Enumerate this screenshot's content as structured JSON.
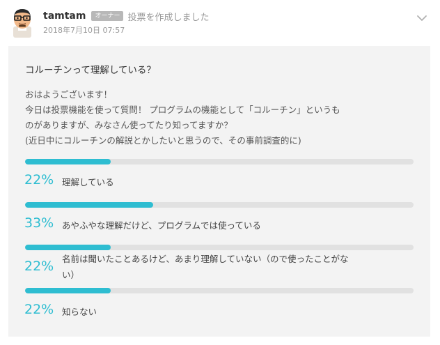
{
  "post": {
    "author": "tamtam",
    "role_badge": "オーナー",
    "action": "投票を作成しました",
    "timestamp": "2018年7月10日 07:57"
  },
  "poll": {
    "question": "コルーチンって理解している？",
    "description": [
      "おはようございます！",
      "今日は投票機能を使って質問！ プログラムの機能として「コルーチン」というも",
      "のがありますが、みなさん使ってたり知ってますか？",
      "(近日中にコルーチンの解説とかしたいと思うので、その事前調査的に)"
    ],
    "options": [
      {
        "percent_label": "22%",
        "fraction": 0.22,
        "label_lines": [
          "理解している"
        ]
      },
      {
        "percent_label": "33%",
        "fraction": 0.33,
        "label_lines": [
          "あやふやな理解だけど、プログラムでは使っている"
        ]
      },
      {
        "percent_label": "22%",
        "fraction": 0.22,
        "label_lines": [
          "名前は聞いたことあるけど、あまり理解していない（ので使ったことがな",
          "い）"
        ]
      },
      {
        "percent_label": "22%",
        "fraction": 0.22,
        "label_lines": [
          "知らない"
        ]
      }
    ]
  },
  "colors": {
    "accent": "#2ebdd1",
    "track": "#e1e1e1",
    "card_bg": "#f3f3f3",
    "badge_bg": "#b8b8b8"
  },
  "icons": {
    "avatar": "glasses-face-avatar",
    "menu": "chevron-down-icon"
  }
}
